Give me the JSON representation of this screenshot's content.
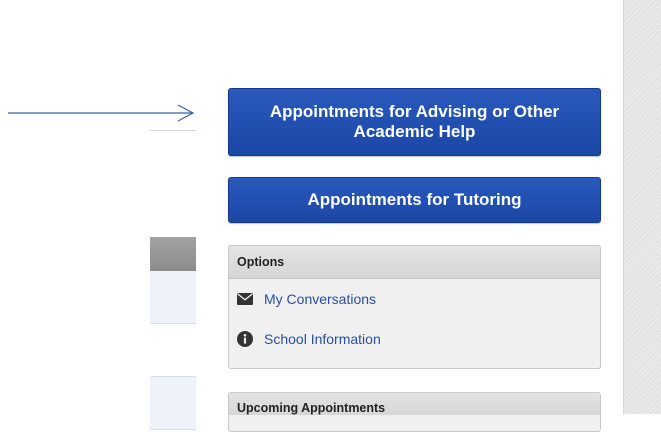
{
  "buttons": {
    "advising_label": "Appointments for Advising or Other Academic Help",
    "tutoring_label": "Appointments for Tutoring"
  },
  "options_panel": {
    "title": "Options",
    "items": [
      {
        "label": "My Conversations",
        "icon": "envelope-icon"
      },
      {
        "label": "School Information",
        "icon": "info-icon"
      }
    ]
  },
  "upcoming_panel": {
    "title": "Upcoming Appointments"
  },
  "colors": {
    "button_blue": "#1f4fb2",
    "link_blue": "#2a4f9e",
    "annotation_arrow": "#3c5f9e"
  }
}
